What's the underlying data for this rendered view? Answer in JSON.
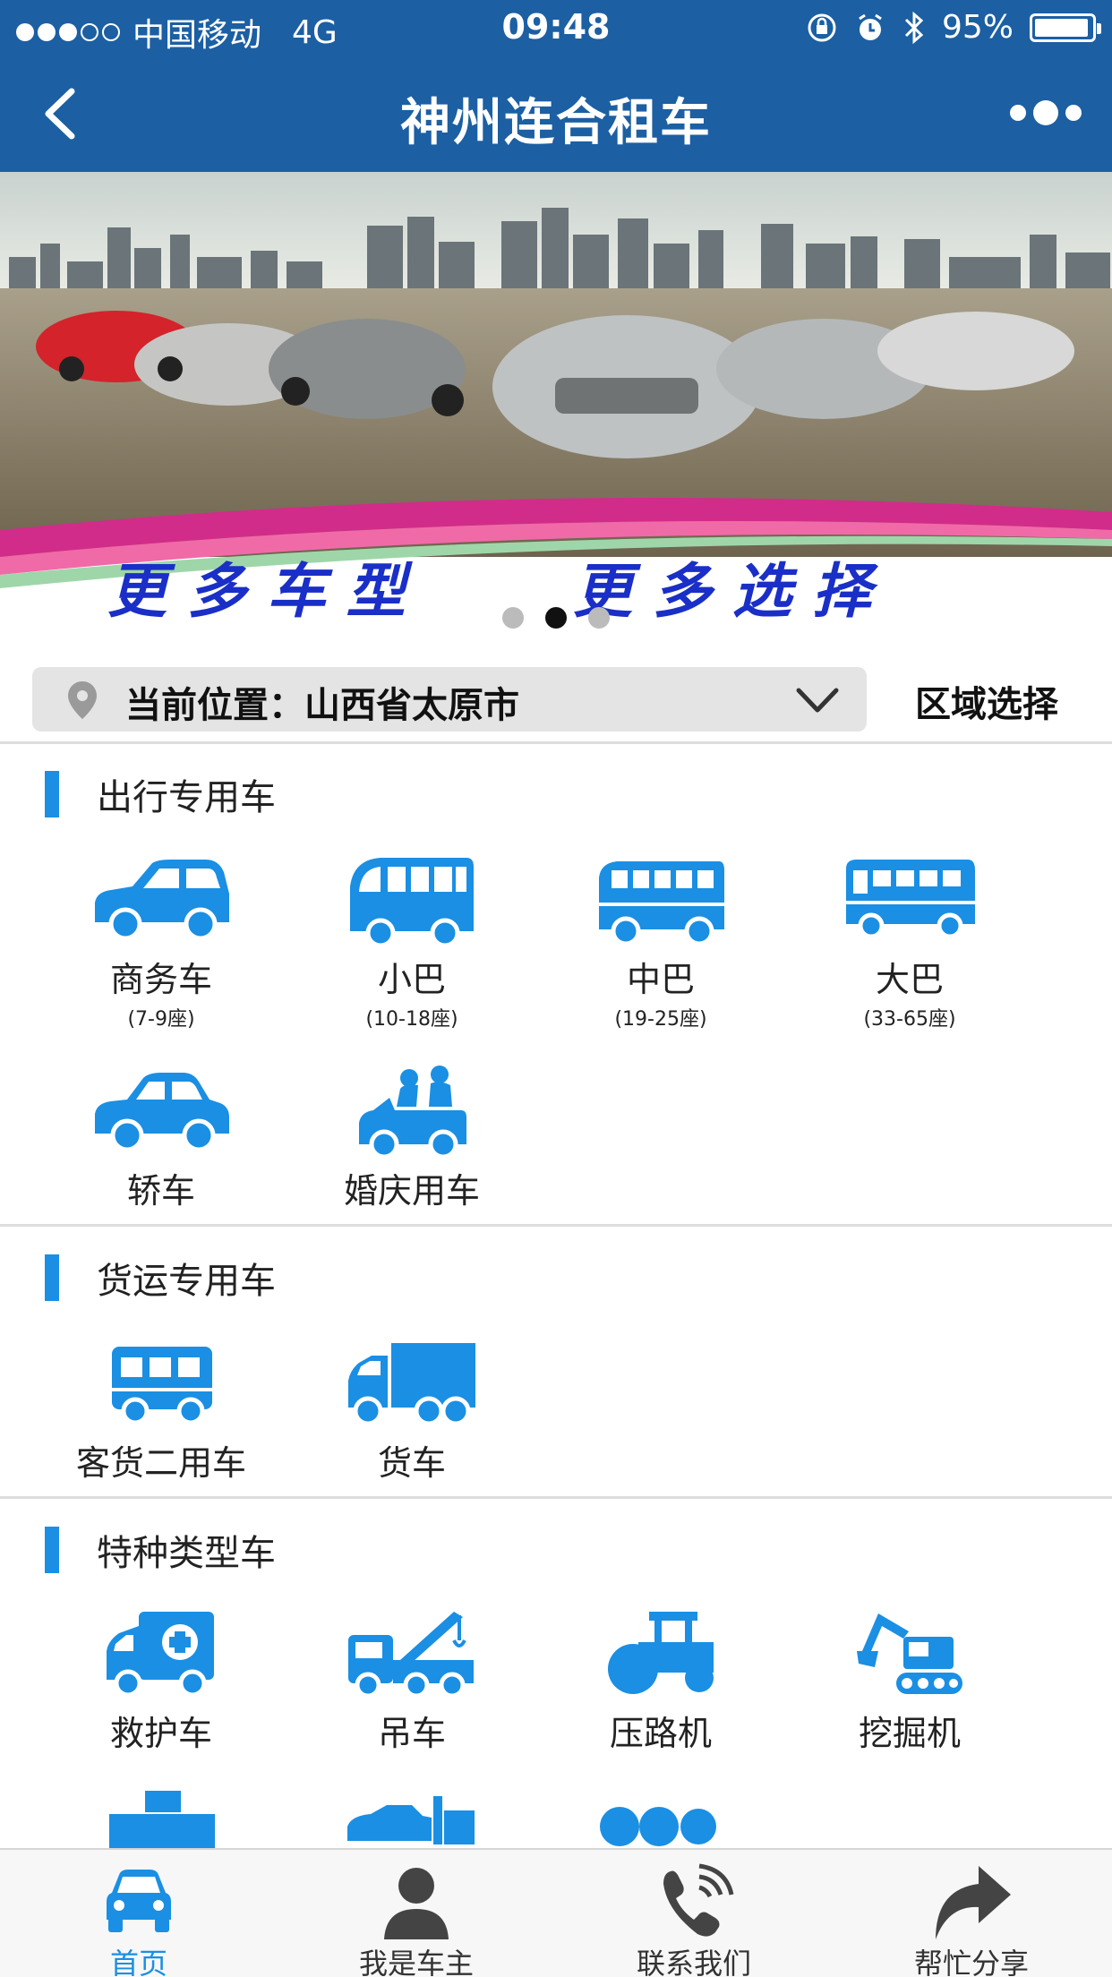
{
  "status_bar": {
    "carrier": "中国移动",
    "network": "4G",
    "time": "09:48",
    "battery": "95%",
    "battery_level": 0.95
  },
  "nav": {
    "title": "神州连合租车"
  },
  "banner": {
    "left_text": "更 多 车 型",
    "right_text": "更 多 选 择",
    "active_index": 1,
    "slide_count": 3
  },
  "location": {
    "text": "当前位置：山西省太原市",
    "region_button": "区域选择"
  },
  "sections": [
    {
      "title": "出行专用车",
      "items": [
        {
          "label": "商务车",
          "sub": "(7-9座)",
          "icon": "mpv-icon"
        },
        {
          "label": "小巴",
          "sub": "(10-18座)",
          "icon": "minibus-icon"
        },
        {
          "label": "中巴",
          "sub": "(19-25座)",
          "icon": "midbus-icon"
        },
        {
          "label": "大巴",
          "sub": "(33-65座)",
          "icon": "coach-icon"
        },
        {
          "label": "轿车",
          "icon": "sedan-icon"
        },
        {
          "label": "婚庆用车",
          "icon": "wedding-car-icon"
        }
      ]
    },
    {
      "title": "货运专用车",
      "items": [
        {
          "label": "客货二用车",
          "icon": "van-icon"
        },
        {
          "label": "货车",
          "icon": "truck-icon"
        }
      ]
    },
    {
      "title": "特种类型车",
      "items": [
        {
          "label": "救护车",
          "icon": "ambulance-icon"
        },
        {
          "label": "吊车",
          "icon": "crane-icon"
        },
        {
          "label": "压路机",
          "icon": "roller-icon"
        },
        {
          "label": "挖掘机",
          "icon": "excavator-icon"
        }
      ]
    }
  ],
  "tabbar": [
    {
      "label": "首页",
      "icon": "car-icon",
      "active": true
    },
    {
      "label": "我是车主",
      "icon": "person-icon",
      "active": false
    },
    {
      "label": "联系我们",
      "icon": "phone-icon",
      "active": false
    },
    {
      "label": "帮忙分享",
      "icon": "share-icon",
      "active": false
    }
  ],
  "colors": {
    "header": "#1c5fa3",
    "accent": "#1a8fe3",
    "banner_text": "#1a2fc7"
  }
}
